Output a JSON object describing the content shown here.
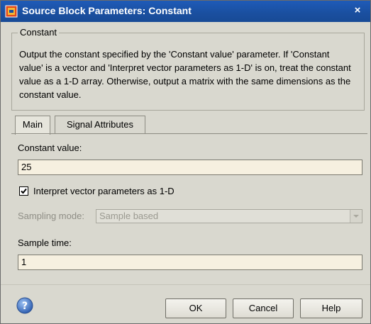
{
  "window": {
    "title": "Source Block Parameters: Constant",
    "close_label": "×"
  },
  "block": {
    "group_label": "Constant",
    "description": "Output the constant specified by the 'Constant value' parameter. If 'Constant value' is a vector and 'Interpret vector parameters as 1-D' is on, treat the constant value as a 1-D array. Otherwise, output a matrix with the same dimensions as the constant value."
  },
  "tabs": [
    {
      "label": "Main",
      "active": true
    },
    {
      "label": "Signal Attributes",
      "active": false
    }
  ],
  "main": {
    "constant_value_label": "Constant value:",
    "constant_value": "25",
    "interpret_label": "Interpret vector parameters as 1-D",
    "interpret_checked": true,
    "sampling_mode_label": "Sampling mode:",
    "sampling_mode_value": "Sample based",
    "sample_time_label": "Sample time:",
    "sample_time_value": "1"
  },
  "buttons": {
    "ok": "OK",
    "cancel": "Cancel",
    "help": "Help"
  },
  "icons": {
    "app": "simulink-block-icon",
    "help": "help-question-icon"
  }
}
